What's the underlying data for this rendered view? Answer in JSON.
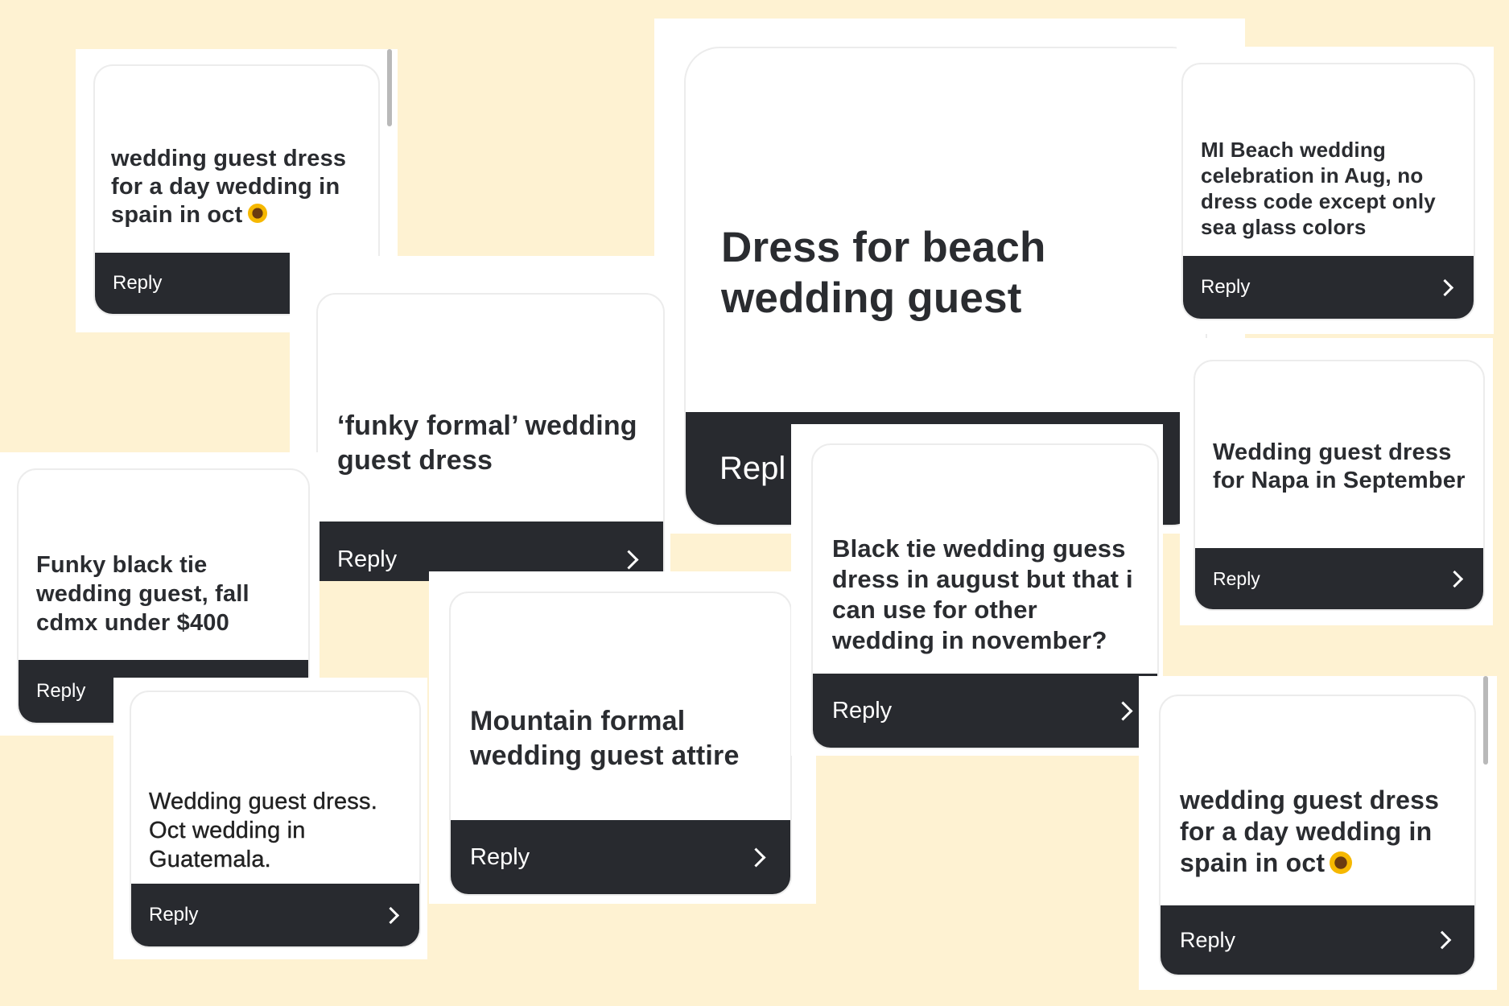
{
  "background_color": "#fef2d2",
  "bar_color": "#282a2f",
  "cards": [
    {
      "question": "wedding guest dress for a day wedding in spain in oct",
      "emoji": "sunflower-icon",
      "reply_label": "Reply"
    },
    {
      "question": "‘funky formal’ wedding guest dress",
      "reply_label": "Reply"
    },
    {
      "question": "Dress for beach wedding guest",
      "reply_label": "Repl"
    },
    {
      "question": "MI Beach wedding celebration in Aug, no dress code except only sea glass colors",
      "reply_label": "Reply"
    },
    {
      "question": "Wedding guest dress for Napa in September",
      "reply_label": "Reply"
    },
    {
      "question": "Funky black tie wedding guest, fall cdmx under $400",
      "reply_label": "Reply"
    },
    {
      "question": "Wedding guest dress. Oct wedding in Guatemala.",
      "reply_label": "Reply"
    },
    {
      "question": "Mountain formal wedding guest attire",
      "reply_label": "Reply"
    },
    {
      "question": "Black tie wedding guess dress in august but that i can use for other wedding in november?",
      "reply_label": "Reply"
    },
    {
      "question": "wedding guest dress for a day wedding in spain in oct",
      "emoji": "sunflower-icon",
      "reply_label": "Reply"
    }
  ]
}
